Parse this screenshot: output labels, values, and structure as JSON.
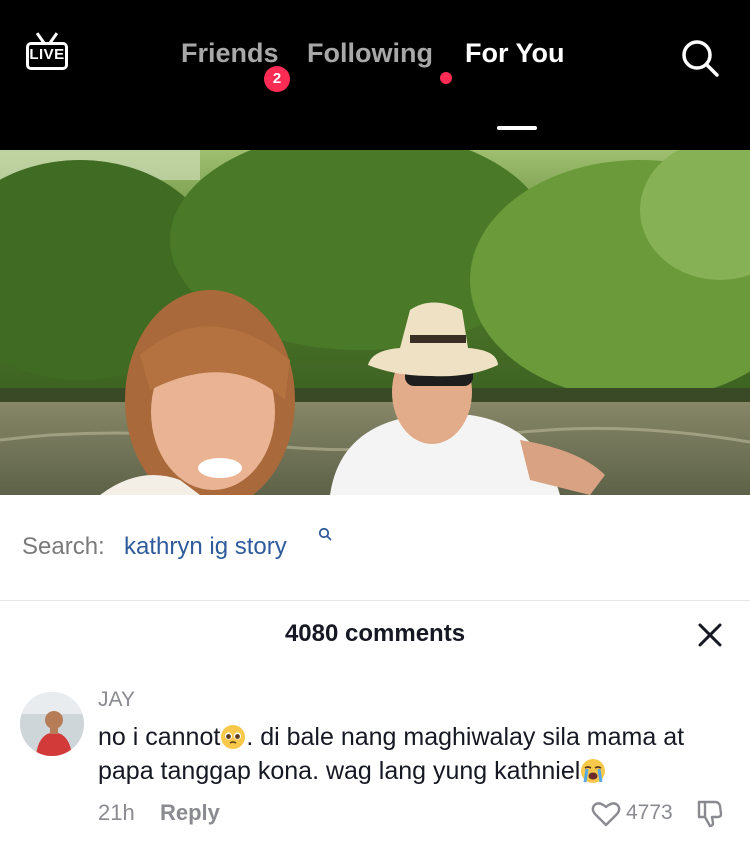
{
  "nav": {
    "live_label": "LIVE",
    "tabs": [
      {
        "label": "Friends",
        "active": false
      },
      {
        "label": "Following",
        "active": false
      },
      {
        "label": "For You",
        "active": true
      }
    ],
    "friends_badge": "2",
    "search_icon": "search-icon",
    "colors": {
      "badge": "#fe2c55",
      "inactive_tab": "#a8a8a8"
    }
  },
  "search_suggestion": {
    "label": "Search:",
    "query": "kathryn ig story"
  },
  "comments": {
    "count_label": "4080 comments",
    "close_icon": "close-icon",
    "items": [
      {
        "user": "JAY",
        "text_part1": "no i cannot",
        "emoji1": "pleading-face-emoji",
        "text_part2": ". di bale nang maghiwalay sila mama at papa tanggap kona. wag lang yung kathniel",
        "emoji2": "loudly-crying-face-emoji",
        "time": "21h",
        "reply_label": "Reply",
        "likes": "4773"
      }
    ]
  }
}
